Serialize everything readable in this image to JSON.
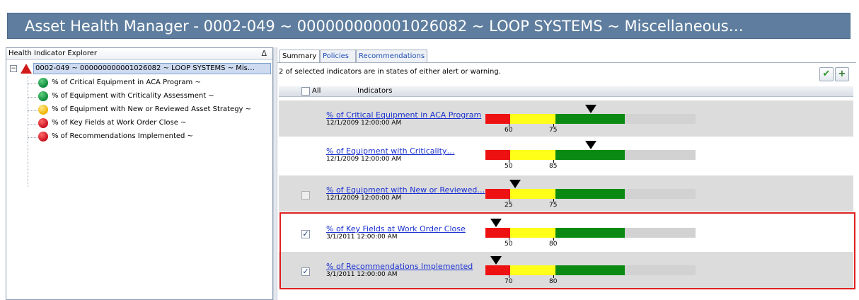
{
  "window": {
    "title": "Asset Health Manager - 0002-049 ~ 000000000001026082 ~ LOOP SYSTEMS ~ Miscellaneous…"
  },
  "explorer": {
    "title": "Health Indicator Explorer",
    "sort_glyph": "Δ",
    "expander_glyph": "−",
    "root": {
      "label": "0002-049 ~ 000000000001026082 ~ LOOP SYSTEMS ~ Mis…",
      "status": "alert"
    },
    "items": [
      {
        "label": "% of Critical Equipment in ACA Program ~",
        "status": "green"
      },
      {
        "label": "% of Equipment with Criticality Assessment ~",
        "status": "green"
      },
      {
        "label": "% of Equipment with New or Reviewed Asset Strategy ~",
        "status": "yellow"
      },
      {
        "label": "% of Key Fields at Work Order Close ~",
        "status": "red"
      },
      {
        "label": "% of Recommendations Implemented ~",
        "status": "red"
      }
    ]
  },
  "tabs": [
    "Summary",
    "Policies",
    "Recommendations"
  ],
  "active_tab": "Summary",
  "summary": {
    "status_text": "2 of selected indicators are in states of either alert or warning.",
    "toolbar": {
      "accept_glyph": "✔",
      "add_glyph": "+"
    },
    "header": {
      "all_label": "All",
      "indicators_label": "Indicators"
    },
    "check_glyph": "✓",
    "rows": [
      {
        "name": "% of Critical Equipment in ACA Program",
        "date": "12/1/2009 12:00:00 AM",
        "checkbox": "none",
        "checked": false,
        "marker_fraction": 0.5,
        "ticks": [
          "60",
          "75"
        ]
      },
      {
        "name": "% of Equipment with Criticality…",
        "date": "12/1/2009 12:00:00 AM",
        "checkbox": "none",
        "checked": false,
        "marker_fraction": 0.5,
        "ticks": [
          "50",
          "85"
        ]
      },
      {
        "name": "% of Equipment with New or Reviewed…",
        "date": "12/1/2009 12:00:00 AM",
        "checkbox": "disabled",
        "checked": false,
        "marker_fraction": 0.143,
        "ticks": [
          "25",
          "75"
        ]
      },
      {
        "name": "% of Key Fields at Work Order Close",
        "date": "3/1/2011 12:00:00 AM",
        "checkbox": "enabled",
        "checked": true,
        "marker_fraction": 0.052,
        "ticks": [
          "50",
          "80"
        ]
      },
      {
        "name": "% of Recommendations Implemented",
        "date": "3/1/2011 12:00:00 AM",
        "checkbox": "enabled",
        "checked": true,
        "marker_fraction": 0.052,
        "ticks": [
          "70",
          "80"
        ]
      }
    ]
  },
  "colors": {
    "titlebar": "#5f7e9f",
    "alert": "#ee1111",
    "warning": "#ffff1a",
    "normal": "#0a8a12",
    "highlight_frame": "#e02020"
  }
}
